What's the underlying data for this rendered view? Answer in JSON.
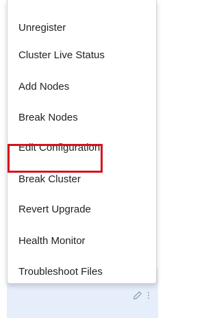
{
  "menu": {
    "items": [
      {
        "label": "Unregister"
      },
      {
        "label": "Cluster Live Status"
      },
      {
        "label": "Add Nodes"
      },
      {
        "label": "Break Nodes"
      },
      {
        "label": "Edit Configuration"
      },
      {
        "label": "Break Cluster",
        "highlighted": true
      },
      {
        "label": "Revert Upgrade"
      },
      {
        "label": "Health Monitor"
      },
      {
        "label": "Troubleshoot Files"
      }
    ]
  },
  "row_actions": {
    "edit_icon": "pencil-icon",
    "more_icon": "kebab-menu-icon"
  },
  "colors": {
    "highlight_border": "#d6121b",
    "selected_row_bg": "#e6edfb",
    "menu_text": "#1f1f1f"
  }
}
